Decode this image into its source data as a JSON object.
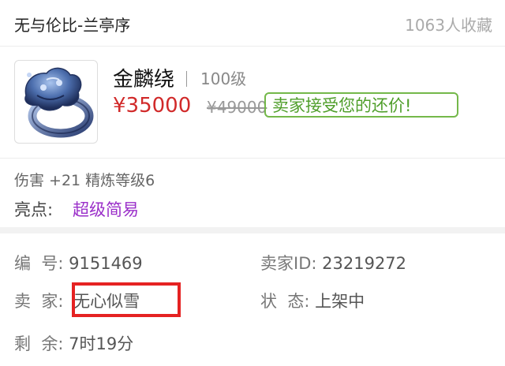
{
  "header": {
    "shop_name": "无与伦比-兰亭序",
    "favorites": "1063人收藏"
  },
  "item": {
    "icon": "jade-ring-item-icon",
    "name": "金麟绕",
    "level": "100级",
    "price": "¥35000",
    "original_price": "¥49000",
    "bargain_badge": "卖家接受您的还价!",
    "stats": "伤害 +21 精炼等级6",
    "highlight_label": "亮点:",
    "highlight_value": "超级简易"
  },
  "details": {
    "id_label": "编  号:",
    "id_value": "9151469",
    "seller_id_label": "卖家ID:",
    "seller_id_value": "23219272",
    "seller_label": "卖  家:",
    "seller_value": "无心似雪",
    "status_label": "状  态:",
    "status_value": "上架中",
    "remaining_label": "剩  余:",
    "remaining_value": "7时19分"
  },
  "colors": {
    "price": "#d12a2a",
    "badge": "#74b84a",
    "highlight": "#9a2ec9",
    "annotation": "#e52222"
  }
}
